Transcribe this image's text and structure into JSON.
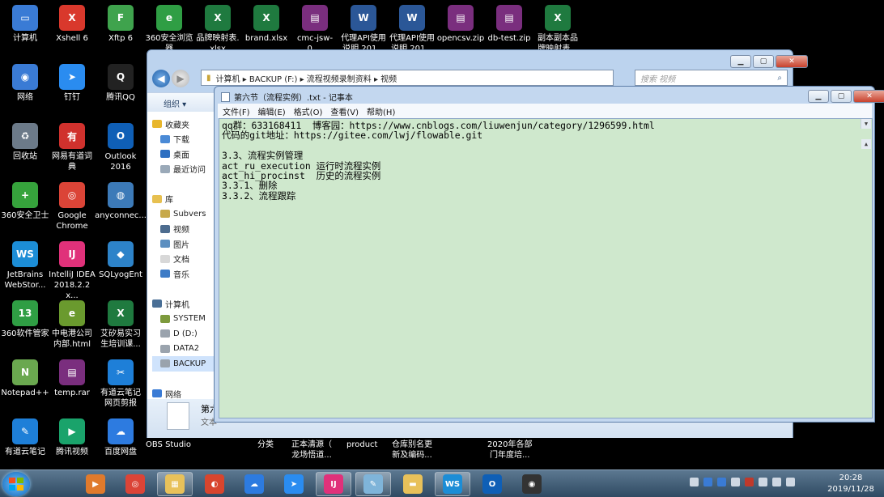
{
  "desktop": {
    "icons": [
      {
        "label": "计算机",
        "icon": "computer-icon",
        "color": "#3a7bd5",
        "glyph": "▭"
      },
      {
        "label": "Xshell 6",
        "icon": "xshell-icon",
        "color": "#d9382c",
        "glyph": "X"
      },
      {
        "label": "Xftp 6",
        "icon": "xftp-icon",
        "color": "#3fa34d",
        "glyph": "F"
      },
      {
        "label": "360安全浏览\n器",
        "icon": "360-browser-icon",
        "color": "#2f9e44",
        "glyph": "e"
      },
      {
        "label": "品牌映射表.\nxlsx",
        "icon": "excel-file-icon",
        "color": "#1f7a3f",
        "glyph": "X"
      },
      {
        "label": "brand.xlsx",
        "icon": "excel-file-icon",
        "color": "#1f7a3f",
        "glyph": "X"
      },
      {
        "label": "cmc-jsw-0....",
        "icon": "rar-archive-icon",
        "color": "#7a2e7e",
        "glyph": "▤"
      },
      {
        "label": "代理API使用\n说明 201...",
        "icon": "word-file-icon",
        "color": "#2b5797",
        "glyph": "W"
      },
      {
        "label": "代理API使用\n说明 201...",
        "icon": "word-file-icon",
        "color": "#2b5797",
        "glyph": "W"
      },
      {
        "label": "opencsv.zip",
        "icon": "zip-archive-icon",
        "color": "#7a2e7e",
        "glyph": "▤"
      },
      {
        "label": "db-test.zip",
        "icon": "zip-archive-icon",
        "color": "#7a2e7e",
        "glyph": "▤"
      },
      {
        "label": "副本副本品\n牌映射表...",
        "icon": "excel-file-icon",
        "color": "#1f7a3f",
        "glyph": "X"
      },
      {
        "label": "网络",
        "icon": "network-icon",
        "color": "#3a7bd5",
        "glyph": "◉"
      },
      {
        "label": "钉钉",
        "icon": "dingtalk-icon",
        "color": "#2a8cf0",
        "glyph": "➤"
      },
      {
        "label": "腾讯QQ",
        "icon": "qq-icon",
        "color": "#222222",
        "glyph": "Q"
      },
      {
        "label": "回收站",
        "icon": "recycle-bin-icon",
        "color": "#6c7a89",
        "glyph": "♻"
      },
      {
        "label": "网易有道词\n典",
        "icon": "youdao-dict-icon",
        "color": "#d0312d",
        "glyph": "有"
      },
      {
        "label": "Outlook\n2016",
        "icon": "outlook-icon",
        "color": "#0f5fb6",
        "glyph": "O"
      },
      {
        "label": "360安全卫士",
        "icon": "360-safe-icon",
        "color": "#36a33c",
        "glyph": "+"
      },
      {
        "label": "Google\nChrome",
        "icon": "chrome-icon",
        "color": "#db4437",
        "glyph": "◎"
      },
      {
        "label": "anyconnec...",
        "icon": "anyconnect-icon",
        "color": "#3c7ab8",
        "glyph": "◍"
      },
      {
        "label": "JetBrains\nWebStor...",
        "icon": "webstorm-icon",
        "color": "#1c8dd6",
        "glyph": "WS"
      },
      {
        "label": "IntelliJ IDEA\n2018.2.2 x...",
        "icon": "intellij-icon",
        "color": "#e0317a",
        "glyph": "IJ"
      },
      {
        "label": "SQLyogEnt",
        "icon": "sqlyog-icon",
        "color": "#2d83c9",
        "glyph": "◆"
      },
      {
        "label": "360软件管家",
        "icon": "360-software-icon",
        "color": "#2f9e44",
        "glyph": "13"
      },
      {
        "label": "中电港公司\n内部.html",
        "icon": "html-file-icon",
        "color": "#6a9a2e",
        "glyph": "e"
      },
      {
        "label": "艾矽易实习\n生培训课...",
        "icon": "excel-file-icon",
        "color": "#1f7a3f",
        "glyph": "X"
      },
      {
        "label": "Notepad++",
        "icon": "notepad-plus-icon",
        "color": "#6aa84f",
        "glyph": "N"
      },
      {
        "label": "temp.rar",
        "icon": "rar-archive-icon",
        "color": "#7a2e7e",
        "glyph": "▤"
      },
      {
        "label": "有道云笔记\n网页剪报",
        "icon": "youdao-clip-icon",
        "color": "#1e7fd8",
        "glyph": "✂"
      },
      {
        "label": "有道云笔记",
        "icon": "youdao-note-icon",
        "color": "#1e7fd8",
        "glyph": "✎"
      },
      {
        "label": "腾讯视频",
        "icon": "tencent-video-icon",
        "color": "#1aa36b",
        "glyph": "▶"
      },
      {
        "label": "百度网盘",
        "icon": "baidu-pan-icon",
        "color": "#2d7be0",
        "glyph": "☁"
      }
    ],
    "bottom_labels": [
      "OBS Studio",
      "分类",
      "正本清源（\n龙场悟道...",
      "product",
      "仓库别名更\n新及编码...",
      "2020年各部\n门年度培..."
    ]
  },
  "explorer": {
    "breadcrumb": [
      "计算机",
      "BACKUP (F:)",
      "流程视频录制资料",
      "视频"
    ],
    "search_placeholder": "搜索 视频",
    "toolbar_organize": "组织 ▾",
    "nav_items": [
      {
        "label": "收藏夹",
        "icon": "star-icon",
        "color": "#e8b62c"
      },
      {
        "label": "下载",
        "icon": "download-folder-icon",
        "color": "#4a8ad6"
      },
      {
        "label": "桌面",
        "icon": "desktop-folder-icon",
        "color": "#2d6fc1"
      },
      {
        "label": "最近访问",
        "icon": "recent-places-icon",
        "color": "#9aa9b8"
      },
      {
        "label": "",
        "icon": "",
        "color": "transparent"
      },
      {
        "label": "库",
        "icon": "library-icon",
        "color": "#e7c050"
      },
      {
        "label": "Subvers",
        "icon": "subversion-icon",
        "color": "#c7a94b"
      },
      {
        "label": "视频",
        "icon": "videos-icon",
        "color": "#4d6c8f"
      },
      {
        "label": "图片",
        "icon": "pictures-icon",
        "color": "#5c8fc0"
      },
      {
        "label": "文档",
        "icon": "documents-icon",
        "color": "#d8d8d8"
      },
      {
        "label": "音乐",
        "icon": "music-icon",
        "color": "#3d7bc6"
      },
      {
        "label": "",
        "icon": "",
        "color": "transparent"
      },
      {
        "label": "计算机",
        "icon": "computer-icon",
        "color": "#4a6f96"
      },
      {
        "label": "SYSTEM",
        "icon": "drive-icon",
        "color": "#7d9a3d"
      },
      {
        "label": "D (D:)",
        "icon": "drive-icon",
        "color": "#9aa3ad"
      },
      {
        "label": "DATA2",
        "icon": "drive-icon",
        "color": "#9aa3ad"
      },
      {
        "label": "BACKUP",
        "icon": "drive-icon",
        "color": "#9aa3ad"
      },
      {
        "label": "",
        "icon": "",
        "color": "transparent"
      },
      {
        "label": "网络",
        "icon": "network-icon",
        "color": "#3a7bd5"
      }
    ],
    "details_name": "第六",
    "details_type": "文本"
  },
  "notepad": {
    "title": "第六节（流程实例）.txt - 记事本",
    "menu": [
      "文件(F)",
      "编辑(E)",
      "格式(O)",
      "查看(V)",
      "帮助(H)"
    ],
    "lines": [
      "qq群：633168411  博客园：https://www.cnblogs.com/liuwenjun/category/1296599.html",
      "代码的git地址：https://gitee.com/lwj/flowable.git",
      "",
      "3.3、流程实例管理",
      "act_ru_execution 运行时流程实例",
      "act_hi_procinst  历史的流程实例",
      "3.3.1、删除",
      "3.3.2、流程跟踪"
    ]
  },
  "taskbar": {
    "items": [
      {
        "icon": "media-player-icon",
        "color": "#e07a2c",
        "glyph": "▶",
        "active": false
      },
      {
        "icon": "chrome-icon",
        "color": "#db4437",
        "glyph": "◎",
        "active": false
      },
      {
        "icon": "file-explorer-icon",
        "color": "#e8c15a",
        "glyph": "▦",
        "active": true
      },
      {
        "icon": "swirl-app-icon",
        "color": "#d8452e",
        "glyph": "◐",
        "active": false
      },
      {
        "icon": "baidu-pan-icon",
        "color": "#2d7be0",
        "glyph": "☁",
        "active": false
      },
      {
        "icon": "dingtalk-icon",
        "color": "#2a8cf0",
        "glyph": "➤",
        "active": false
      },
      {
        "icon": "intellij-icon",
        "color": "#e0317a",
        "glyph": "IJ",
        "active": true
      },
      {
        "icon": "notepad-icon",
        "color": "#7fb4d9",
        "glyph": "✎",
        "active": true
      },
      {
        "icon": "folder-icon",
        "color": "#e8c15a",
        "glyph": "▬",
        "active": false
      },
      {
        "icon": "webstorm-icon",
        "color": "#1c8dd6",
        "glyph": "WS",
        "active": true
      },
      {
        "icon": "outlook-icon",
        "color": "#0f5fb6",
        "glyph": "O",
        "active": false
      },
      {
        "icon": "obs-icon",
        "color": "#333333",
        "glyph": "◉",
        "active": false
      }
    ],
    "tray_icons": [
      "chevron-up-icon",
      "help-icon",
      "bluetooth-icon",
      "lang-icon",
      "record-icon",
      "network-signal-icon",
      "volume-icon",
      "wifi-icon"
    ],
    "time": "20:28",
    "date": "2019/11/28"
  }
}
